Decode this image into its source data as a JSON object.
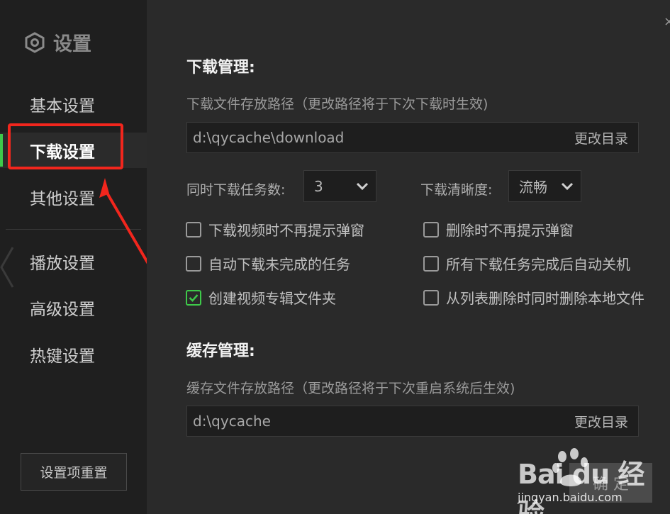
{
  "sidebar": {
    "title": "设置",
    "items": [
      {
        "label": "基本设置"
      },
      {
        "label": "下载设置"
      },
      {
        "label": "其他设置"
      },
      {
        "label": "播放设置"
      },
      {
        "label": "高级设置"
      },
      {
        "label": "热键设置"
      }
    ],
    "active_index": 1,
    "reset_label": "设置项重置"
  },
  "download": {
    "title": "下载管理:",
    "path_label": "下载文件存放路径（更改路径将于下次下载时生效)",
    "path_value": "d:\\qycache\\download",
    "change_dir_label": "更改目录",
    "tasks_label": "同时下载任务数:",
    "tasks_value": "3",
    "quality_label": "下载清晰度:",
    "quality_value": "流畅",
    "options": [
      {
        "label": "下载视频时不再提示弹窗",
        "checked": false
      },
      {
        "label": "删除时不再提示弹窗",
        "checked": false
      },
      {
        "label": "自动下载未完成的任务",
        "checked": false
      },
      {
        "label": "所有下载任务完成后自动关机",
        "checked": false
      },
      {
        "label": "创建视频专辑文件夹",
        "checked": true
      },
      {
        "label": "从列表删除时同时删除本地文件",
        "checked": false
      }
    ]
  },
  "cache": {
    "title": "缓存管理:",
    "path_label": "缓存文件存放路径（更改路径将于下次重启系统后生效)",
    "path_value": "d:\\qycache",
    "change_dir_label": "更改目录"
  },
  "footer": {
    "confirm_label": "确 定"
  },
  "watermark": {
    "brand": "Bai du 经验",
    "url": "jingyan.baidu.com"
  },
  "colors": {
    "accent": "#3ec94a",
    "highlight": "#f2261d"
  }
}
